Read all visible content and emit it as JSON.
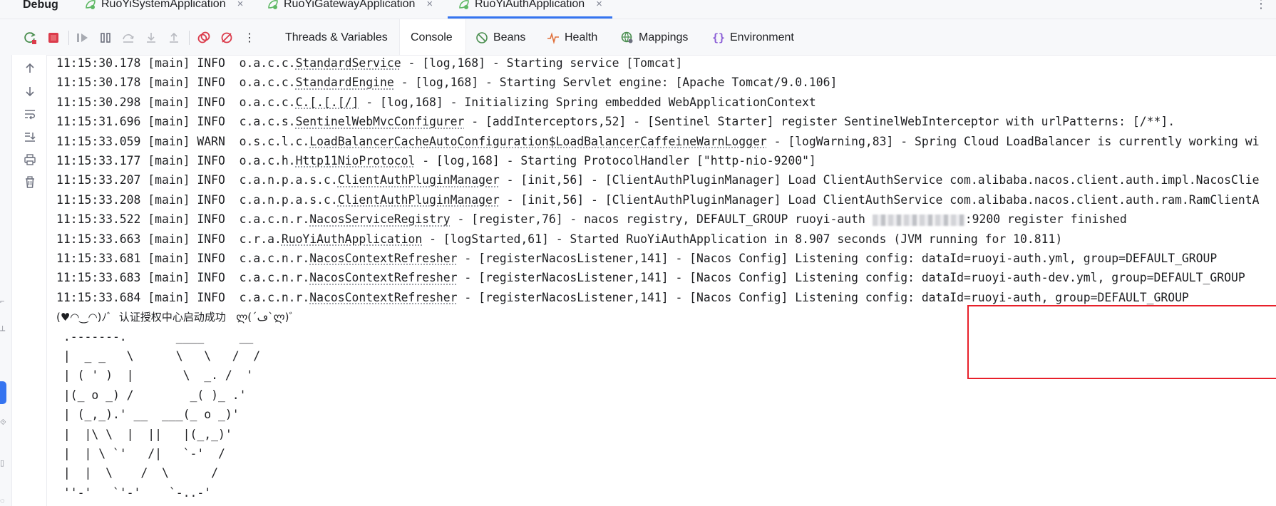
{
  "debug_bar": {
    "title": "Debug",
    "tabs": [
      {
        "label": "RuoYiSystemApplication",
        "close": "×",
        "active": false
      },
      {
        "label": "RuoYiGatewayApplication",
        "close": "×",
        "active": false
      },
      {
        "label": "RuoYiAuthApplication",
        "close": "×",
        "active": true
      }
    ],
    "menu": "⋮"
  },
  "toolbar": {
    "tabs": [
      "Threads & Variables",
      "Console",
      "Beans",
      "Health",
      "Mappings",
      "Environment"
    ],
    "more": "⋮"
  },
  "log_lines": [
    {
      "time": "11:15:30.178",
      "thread": "[main]",
      "level": "INFO ",
      "pkg": "o.a.c.c.",
      "cls": "StandardService",
      "msg": " - [log,168] - Starting service [Tomcat]"
    },
    {
      "time": "11:15:30.178",
      "thread": "[main]",
      "level": "INFO ",
      "pkg": "o.a.c.c.",
      "cls": "StandardEngine",
      "msg": " - [log,168] - Starting Servlet engine: [Apache Tomcat/9.0.106]"
    },
    {
      "time": "11:15:30.298",
      "thread": "[main]",
      "level": "INFO ",
      "pkg": "o.a.c.c.",
      "cls": "C.[.[.[/]",
      "msg": " - [log,168] - Initializing Spring embedded WebApplicationContext"
    },
    {
      "time": "11:15:31.696",
      "thread": "[main]",
      "level": "INFO ",
      "pkg": "c.a.c.s.",
      "cls": "SentinelWebMvcConfigurer",
      "msg": " - [addInterceptors,52] - [Sentinel Starter] register SentinelWebInterceptor with urlPatterns: [/**]."
    },
    {
      "time": "11:15:33.059",
      "thread": "[main]",
      "level": "WARN ",
      "pkg": "o.s.c.l.c.",
      "cls": "LoadBalancerCacheAutoConfiguration$LoadBalancerCaffeineWarnLogger",
      "msg": " - [logWarning,83] - Spring Cloud LoadBalancer is currently working wi"
    },
    {
      "time": "11:15:33.177",
      "thread": "[main]",
      "level": "INFO ",
      "pkg": "o.a.c.h.",
      "cls": "Http11NioProtocol",
      "msg": " - [log,168] - Starting ProtocolHandler [\"http-nio-9200\"]"
    },
    {
      "time": "11:15:33.207",
      "thread": "[main]",
      "level": "INFO ",
      "pkg": "c.a.n.p.a.s.c.",
      "cls": "ClientAuthPluginManager",
      "msg": " - [init,56] - [ClientAuthPluginManager] Load ClientAuthService com.alibaba.nacos.client.auth.impl.NacosClie"
    },
    {
      "time": "11:15:33.208",
      "thread": "[main]",
      "level": "INFO ",
      "pkg": "c.a.n.p.a.s.c.",
      "cls": "ClientAuthPluginManager",
      "msg": " - [init,56] - [ClientAuthPluginManager] Load ClientAuthService com.alibaba.nacos.client.auth.ram.RamClientA"
    },
    {
      "time": "11:15:33.522",
      "thread": "[main]",
      "level": "INFO ",
      "pkg": "c.a.c.n.r.",
      "cls": "NacosServiceRegistry",
      "msg": " - [register,76] - nacos registry, DEFAULT_GROUP ruoyi-auth ",
      "redacted": true,
      "msg_after": ":9200 register finished"
    },
    {
      "time": "11:15:33.663",
      "thread": "[main]",
      "level": "INFO ",
      "pkg": "c.r.a.",
      "cls": "RuoYiAuthApplication",
      "msg": " - [logStarted,61] - Started RuoYiAuthApplication in 8.907 seconds (JVM running for 10.811)"
    },
    {
      "time": "11:15:33.681",
      "thread": "[main]",
      "level": "INFO ",
      "pkg": "c.a.c.n.r.",
      "cls": "NacosContextRefresher",
      "msg": " - [registerNacosListener,141] - [Nacos Config] Listening config: dataId=ruoyi-auth.yml, group=DEFAULT_GROUP"
    },
    {
      "time": "11:15:33.683",
      "thread": "[main]",
      "level": "INFO ",
      "pkg": "c.a.c.n.r.",
      "cls": "NacosContextRefresher",
      "msg": " - [registerNacosListener,141] - [Nacos Config] Listening config: dataId=ruoyi-auth-dev.yml, group=DEFAULT_GROUP"
    },
    {
      "time": "11:15:33.684",
      "thread": "[main]",
      "level": "INFO ",
      "pkg": "c.a.c.n.r.",
      "cls": "NacosContextRefresher",
      "msg": " - [registerNacosListener,141] - [Nacos Config] Listening config: dataId=ruoyi-auth, group=DEFAULT_GROUP"
    }
  ],
  "banner": {
    "title_left": "(♥◠‿◠)ﾉﾞ ",
    "title_text": " 认证授权中心启动成功 ",
    "title_right": "  ლ(´ڡ`ლ)ﾞ",
    "art": [
      " .-------.       ____     __",
      " |  _ _   \\      \\   \\   /  /",
      " | ( ' )  |       \\  _. /  '",
      " |(_ o _) /        _( )_ .'",
      " | (_,_).' __  ___(_ o _)'",
      " |  |\\ \\  |  ||   |(_,_)'",
      " |  | \\ `'   /|   `-'  /",
      " |  |  \\    /  \\      /",
      " ''-'   `'-'    `-..-'"
    ]
  },
  "colors": {
    "accent": "#3574f0",
    "stop_red": "#db3b4b",
    "highlight_box": "#e8202a",
    "run_icon_green": "#5fb865"
  }
}
